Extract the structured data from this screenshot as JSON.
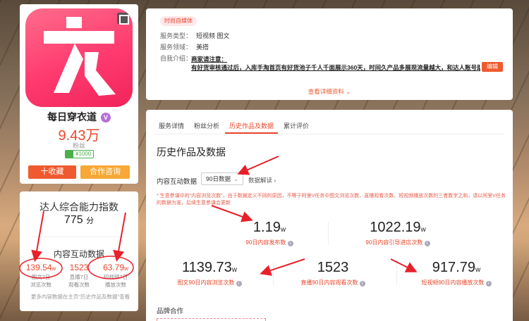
{
  "profile": {
    "name": "每日穿衣道",
    "verified_mark": "V",
    "fans_count": "9.43万",
    "fans_label": "粉丝",
    "price_badge": "¥1000",
    "collect_button": "十收藏",
    "coop_button": "合作咨询"
  },
  "ability": {
    "title": "达人综合能力指数",
    "score": "775",
    "score_unit": "分",
    "subtitle": "内容互动数据",
    "metrics": [
      {
        "value": "139.54",
        "unit": "w",
        "label_line1": "图文7日",
        "label_line2": "浏览次数"
      },
      {
        "value": "1523",
        "unit": "",
        "label_line1": "直播7日",
        "label_line2": "观看次数"
      },
      {
        "value": "63.79",
        "unit": "w",
        "label_line1": "短视频7日",
        "label_line2": "播放次数"
      }
    ],
    "footer": "更多内容数据在主页\"历史作品及数据\"查看"
  },
  "info": {
    "tag": "时尚自媒体",
    "service_type_label": "服务类型：",
    "service_type_value": "短视频 图文",
    "service_area_label": "服务领域：",
    "service_area_value": "美搭",
    "intro_label": "自我介绍：",
    "intro_line1": "商家请注意：",
    "intro_line2": "有好货审核通过后，入库手淘首页有好货池子千人千面展示360天，时间久产品多展现流量越大，和达人账号助",
    "edit_button": "编辑",
    "more_link": "查看详细资料"
  },
  "main": {
    "tabs": [
      "服务详情",
      "粉丝分析",
      "历史作品及数据",
      "累计评价"
    ],
    "active_tab": 2,
    "title": "历史作品及数据",
    "control_label": "内容互动数据",
    "select_value": "90日数据",
    "interpret_link": "数据解读",
    "note": "* 生意参谋中的\"内容浏览次数\"，由于数据定义不同的原因，不等于阿里V任务中图文浏览次数、直播观看次数、短视频播放次数的三者数字之和，请以阿里V任务的数据为准，后续生意参谋会更新",
    "metrics": [
      {
        "value": "1.19",
        "unit": "w",
        "label": "90日内容发布数"
      },
      {
        "value": "1022.19",
        "unit": "w",
        "label": "90日内容引导进店次数"
      },
      {
        "value": "1139.73",
        "unit": "w",
        "label": "图文90日内容浏览次数"
      },
      {
        "value": "1523",
        "unit": "",
        "label": "直播90日内容观看次数"
      },
      {
        "value": "917.79",
        "unit": "w",
        "label": "短视频90日内容播放次数"
      }
    ],
    "brand_section": "品牌合作"
  },
  "colors": {
    "accent_red": "#e8472c",
    "brand_pink": "#ff3a6e",
    "orange_button": "#ef5a2e",
    "yellow_button": "#f7a836"
  }
}
